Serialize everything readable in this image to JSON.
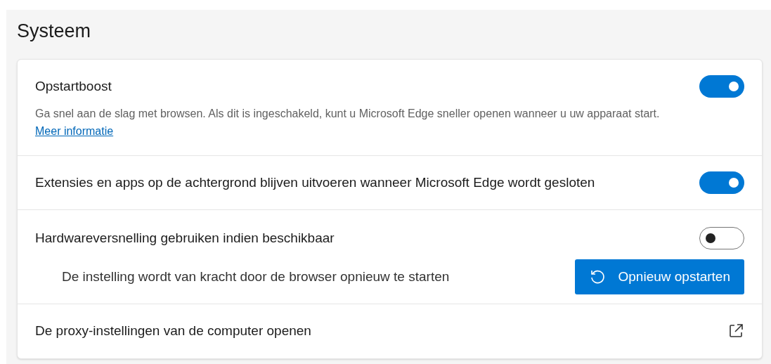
{
  "title": "Systeem",
  "settings": [
    {
      "kind": "toggle",
      "label": "Opstartboost",
      "on": true,
      "description": "Ga snel aan de slag met browsen. Als dit is ingeschakeld, kunt u Microsoft Edge sneller openen wanneer u uw apparaat start.",
      "link": "Meer informatie"
    },
    {
      "kind": "toggle",
      "label": "Extensies en apps op de achtergrond blijven uitvoeren wanneer Microsoft Edge wordt gesloten",
      "on": true
    },
    {
      "kind": "toggle",
      "label": "Hardwareversnelling gebruiken indien beschikbaar",
      "on": false,
      "note": "De instelling wordt van kracht door de browser opnieuw te starten",
      "button": "Opnieuw opstarten"
    },
    {
      "kind": "external",
      "label": "De proxy-instellingen van de computer openen"
    }
  ]
}
